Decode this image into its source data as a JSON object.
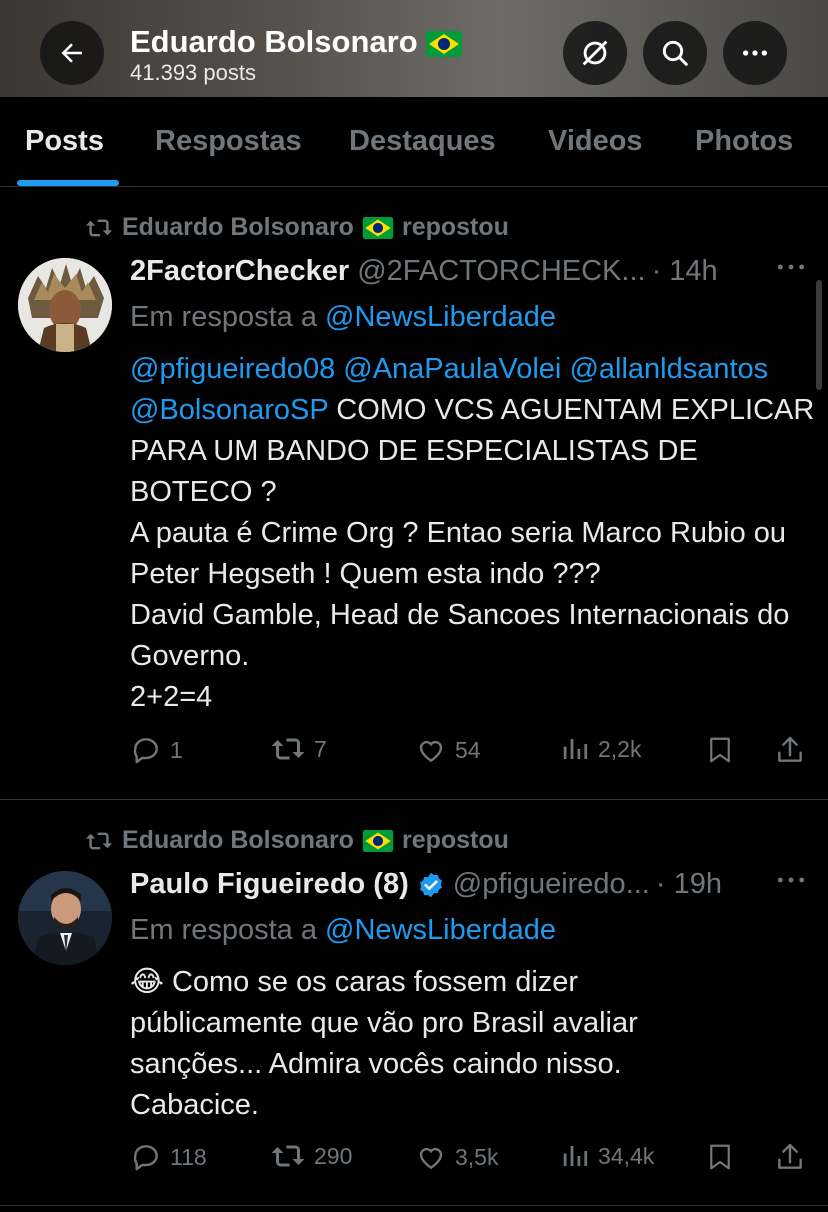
{
  "header": {
    "profile_name": "Eduardo Bolsonaro",
    "post_count": "41.393 posts",
    "flag_icon": "brazil-flag-icon"
  },
  "tabs": [
    {
      "label": "Posts",
      "active": true
    },
    {
      "label": "Respostas",
      "active": false
    },
    {
      "label": "Destaques",
      "active": false
    },
    {
      "label": "Videos",
      "active": false
    },
    {
      "label": "Photos",
      "active": false
    }
  ],
  "tweets": [
    {
      "reposted_by": "Eduardo Bolsonaro",
      "reposted_label": "repostou",
      "author_name": "2FactorChecker",
      "author_handle": "@2FACTORCHECK...",
      "time": "· 14h",
      "reply_prefix": "Em resposta a",
      "reply_to": "@NewsLiberdade",
      "body": {
        "m1": "@pfigueiredo08",
        "m2": "@AnaPaulaVolei",
        "m3": "@allanldsantos",
        "m4": "@BolsonaroSP",
        "t1": " COMO VCS AGUENTAM EXPLICAR PARA UM BANDO DE ESPECIALISTAS DE BOTECO ?",
        "t2": "A pauta é Crime Org ? Entao seria Marco Rubio ou Peter Hegseth ! Quem esta indo ???",
        "t3": "David Gamble, Head de Sancoes Internacionais do Governo.",
        "t4": "2+2=4"
      },
      "stats": {
        "replies": "1",
        "reposts": "7",
        "likes": "54",
        "views": "2,2k"
      }
    },
    {
      "reposted_by": "Eduardo Bolsonaro",
      "reposted_label": "repostou",
      "author_name": "Paulo Figueiredo (8)",
      "author_handle": "@pfigueiredo...",
      "time": "· 19h",
      "reply_prefix": "Em resposta a",
      "reply_to": "@NewsLiberdade",
      "body": {
        "emoji": "😂",
        "t1": " Como se os caras fossem dizer públicamente que vão pro Brasil avaliar sanções... Admira vocês caindo nisso. Cabacice."
      },
      "stats": {
        "replies": "118",
        "reposts": "290",
        "likes": "3,5k",
        "views": "34,4k"
      }
    }
  ],
  "colors": {
    "accent": "#1d9bf0",
    "muted": "#71767b",
    "text": "#e7e9ea",
    "background": "#000000"
  }
}
